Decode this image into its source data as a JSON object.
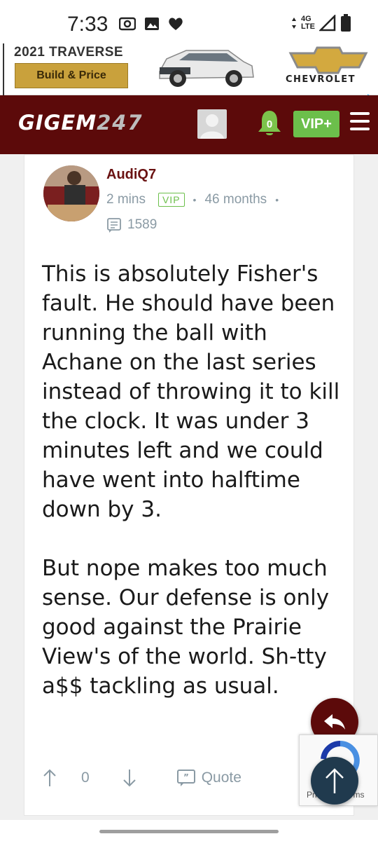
{
  "status_bar": {
    "time": "7:33",
    "network_top": "4G",
    "network_bottom": "LTE"
  },
  "ad": {
    "model": "2021 TRAVERSE",
    "cta": "Build & Price",
    "brand": "CHEVROLET"
  },
  "header": {
    "logo_text": "GIGEM",
    "logo_num": "247",
    "notification_count": "0",
    "vip_label": "VIP+"
  },
  "post": {
    "username": "AudiQ7",
    "time_ago": "2 mins",
    "badge": "VIP",
    "tenure": "46 months",
    "post_count": "1589",
    "paragraph1": "This is absolutely Fisher's fault. He should have been running the ball with Achane on the last series instead of throwing it to kill the clock. It was under 3 minutes left and we could have went into halftime down by 3.",
    "paragraph2": "But nope makes too much sense. Our defense is only good against the Prairie View's of the world. Sh-tty a$$ tackling as usual.",
    "vote_count": "0",
    "quote_label": "Quote"
  },
  "recaptcha": {
    "terms_text": "Privacy - Terms"
  },
  "colors": {
    "header_bg": "#5c0a0a",
    "vip_green": "#6cbf4b",
    "username": "#6a1212",
    "meta": "#8a9aa4",
    "scroll_top_fab": "#203a4e"
  }
}
